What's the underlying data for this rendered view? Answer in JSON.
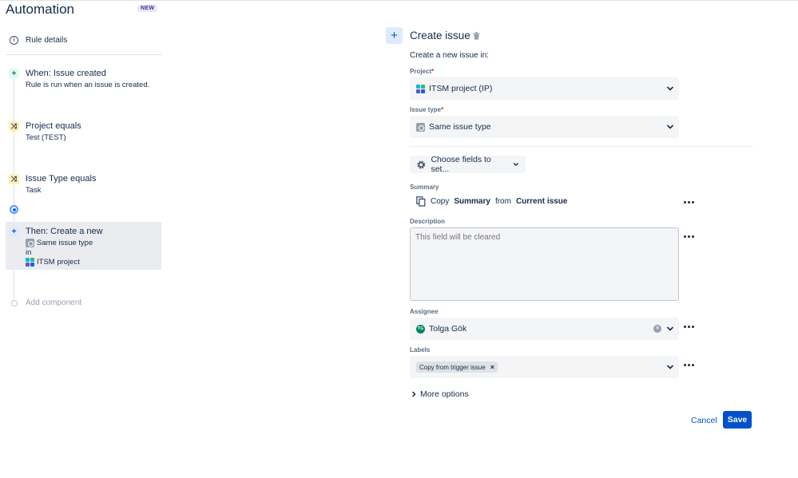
{
  "app": {
    "title": "Automation",
    "badge": "NEW"
  },
  "sidebar": {
    "rule_details": "Rule details",
    "nodes": [
      {
        "title": "When: Issue created",
        "subtitle": "Rule is run when an issue is created."
      },
      {
        "title": "Project equals",
        "subtitle": "Test (TEST)"
      },
      {
        "title": "Issue Type equals",
        "subtitle": "Task"
      },
      {
        "title": "Then: Create a new",
        "line1": "Same issue type",
        "line2": "in",
        "line3": "ITSM project"
      }
    ],
    "add_component": "Add component"
  },
  "panel": {
    "title": "Create issue",
    "create_in": "Create a new issue in:",
    "project_label": "Project",
    "project_value": "ITSM project (IP)",
    "issue_type_label": "Issue type",
    "issue_type_value": "Same issue type",
    "required_mark": "*",
    "choose_fields": "Choose fields to set...",
    "summary_label": "Summary",
    "summary_copy": "Copy",
    "summary_field": "Summary",
    "summary_from": "from",
    "summary_source": "Current issue",
    "description_label": "Description",
    "description_placeholder": "This field will be cleared",
    "assignee_label": "Assignee",
    "assignee_initials": "TG",
    "assignee_value": "Tolga Gök",
    "labels_label": "Labels",
    "label_chip": "Copy from trigger issue",
    "more_options": "More options",
    "cancel": "Cancel",
    "save": "Save"
  },
  "colors": {
    "accent": "#0052cc",
    "trigger": "#00875a",
    "condition": "#fff0b3"
  }
}
